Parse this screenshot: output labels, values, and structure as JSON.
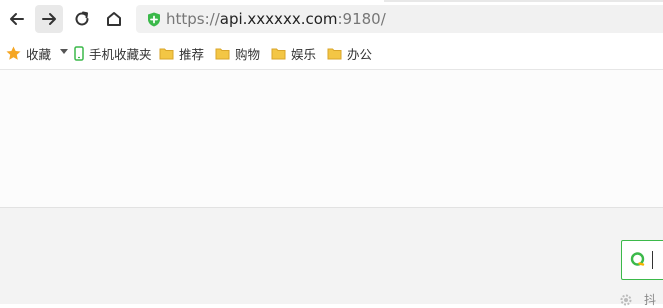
{
  "toolbar": {
    "back_icon": "arrow-left-icon",
    "forward_icon": "arrow-right-icon",
    "reload_icon": "reload-icon",
    "home_icon": "home-icon"
  },
  "address_bar": {
    "scheme": "https://",
    "host": "api.xxxxxx.com",
    "port_path": ":9180/",
    "security_icon": "shield-plus-icon",
    "accent_color": "#3bb94a"
  },
  "bookmarks": {
    "favorites_label": "收藏",
    "mobile_label": "手机收藏夹",
    "folders": [
      "推荐",
      "购物",
      "娱乐",
      "办公"
    ],
    "star_color": "#f5a623",
    "folder_color": "#f3c645"
  },
  "page": {
    "partial_text": "抖"
  }
}
